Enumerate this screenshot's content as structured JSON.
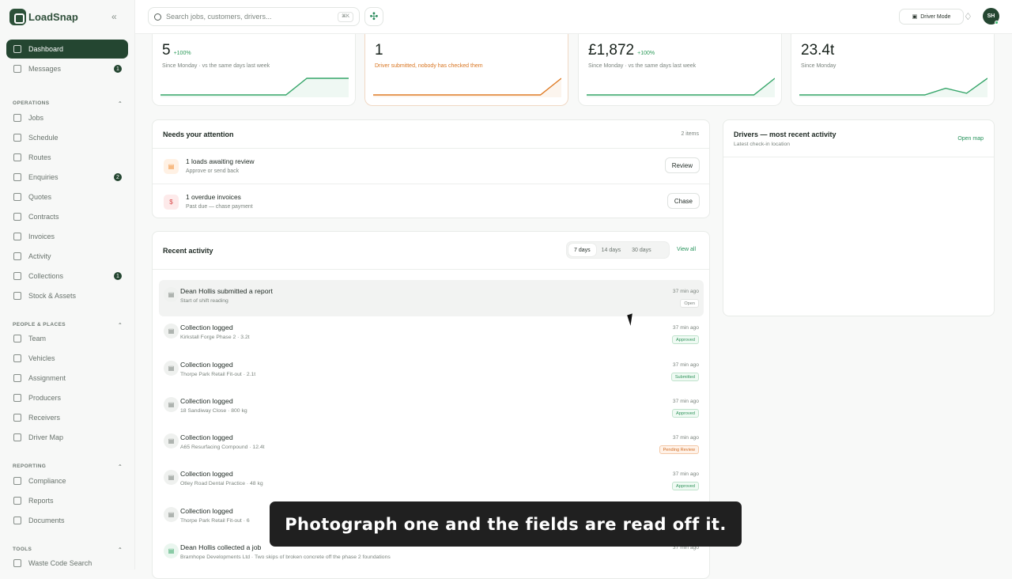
{
  "brand": {
    "name": "LoadSnap"
  },
  "sidebar": {
    "items": [
      {
        "label": "Dashboard",
        "active": true
      },
      {
        "label": "Messages",
        "count": "1"
      },
      {
        "section": "OPERATIONS"
      },
      {
        "label": "Jobs"
      },
      {
        "label": "Schedule"
      },
      {
        "label": "Routes"
      },
      {
        "label": "Enquiries",
        "count": "2"
      },
      {
        "label": "Quotes"
      },
      {
        "label": "Contracts"
      },
      {
        "label": "Invoices"
      },
      {
        "label": "Activity"
      },
      {
        "label": "Collections",
        "count": "1"
      },
      {
        "label": "Stock & Assets"
      },
      {
        "section": "PEOPLE & PLACES"
      },
      {
        "label": "Team"
      },
      {
        "label": "Vehicles"
      },
      {
        "label": "Assignment"
      },
      {
        "label": "Producers"
      },
      {
        "label": "Receivers"
      },
      {
        "label": "Driver Map"
      },
      {
        "section": "REPORTING"
      },
      {
        "label": "Compliance"
      },
      {
        "label": "Reports"
      },
      {
        "label": "Documents"
      },
      {
        "section": "TOOLS"
      },
      {
        "label": "Waste Code Search"
      }
    ]
  },
  "topbar": {
    "search_placeholder": "Search jobs, customers, drivers...",
    "shortcut": "⌘K",
    "driver_mode": "Driver Mode",
    "user_initials": "SH"
  },
  "stats": [
    {
      "value": "5",
      "change": "+100%",
      "note": "Since Monday · vs the same days last week",
      "sparkline": [
        0,
        0,
        0,
        0,
        0,
        0,
        0,
        1,
        1,
        1
      ]
    },
    {
      "value": "1",
      "change": "",
      "note": "Driver submitted, nobody has checked them",
      "sparkline": [
        0,
        0,
        0,
        0,
        0,
        0,
        0,
        0,
        0,
        1
      ]
    },
    {
      "value": "£1,872",
      "change": "+100%",
      "note": "Since Monday · vs the same days last week",
      "sparkline": [
        0,
        0,
        0,
        0,
        0,
        0,
        0,
        0,
        0,
        1
      ]
    },
    {
      "value": "23.4t",
      "change": "",
      "note": "Since Monday",
      "sparkline": [
        0,
        0,
        0,
        0,
        0,
        0,
        0,
        0.4,
        0.1,
        1
      ]
    }
  ],
  "attention": {
    "title": "Needs your attention",
    "count": "2 items",
    "rows": [
      {
        "title": "1 loads awaiting review",
        "subtitle": "Approve or send back",
        "action": "Review",
        "icon": "inbox-icon",
        "color": "#f4a64b"
      },
      {
        "title": "1 overdue invoices",
        "subtitle": "Past due — chase payment",
        "action": "Chase",
        "icon": "pound-icon",
        "color": "#d94a4a"
      }
    ]
  },
  "drivers": {
    "title": "Drivers — most recent activity",
    "subtitle": "Latest check-in location",
    "action": "Open map"
  },
  "activity": {
    "title": "Recent activity",
    "ranges": [
      "7 days",
      "14 days",
      "30 days"
    ],
    "view_all": "View all",
    "items": [
      {
        "title": "Dean Hollis submitted a report",
        "subtitle": "Start of shift reading",
        "time": "37 min ago",
        "status": "Open",
        "status_type": "open"
      },
      {
        "title": "Collection logged",
        "subtitle": "Kirkstall Forge Phase 2 · 3.2t",
        "time": "37 min ago",
        "status": "Approved",
        "status_type": "approved"
      },
      {
        "title": "Collection logged",
        "subtitle": "Thorpe Park Retail Fit-out · 2.1t",
        "time": "37 min ago",
        "status": "Submitted",
        "status_type": "submitted"
      },
      {
        "title": "Collection logged",
        "subtitle": "18 Sandiway Close · 800 kg",
        "time": "37 min ago",
        "status": "Approved",
        "status_type": "approved"
      },
      {
        "title": "Collection logged",
        "subtitle": "A65 Resurfacing Compound · 12.4t",
        "time": "37 min ago",
        "status": "Pending Review",
        "status_type": "pending"
      },
      {
        "title": "Collection logged",
        "subtitle": "Otley Road Dental Practice · 48 kg",
        "time": "37 min ago",
        "status": "Approved",
        "status_type": "approved"
      },
      {
        "title": "Collection logged",
        "subtitle": "Thorpe Park Retail Fit-out · 6",
        "time": "",
        "status": "",
        "status_type": "none"
      },
      {
        "title": "Dean Hollis collected a job",
        "subtitle": "Bramhope Developments Ltd · Two skips of broken concrete off the phase 2 foundations",
        "time": "37 min ago",
        "status": "",
        "status_type": "none",
        "icon_type": "green"
      }
    ]
  },
  "caption": "Photograph one and the fields are read off it."
}
